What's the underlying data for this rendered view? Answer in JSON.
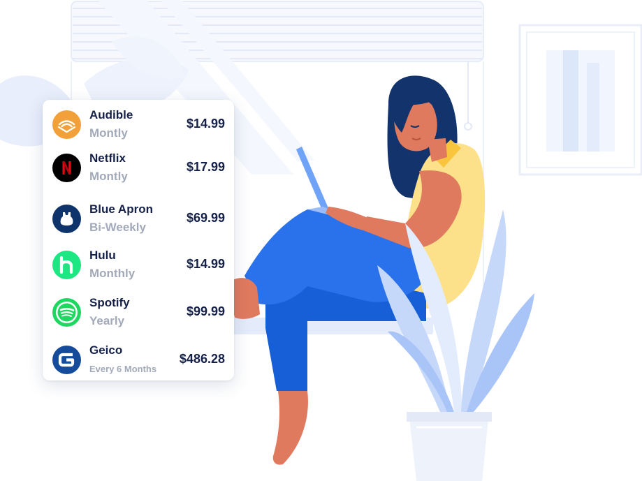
{
  "colors": {
    "background": "#ffffff",
    "text_primary": "#152148",
    "text_secondary": "#a2a9b8",
    "card": "#ffffff",
    "illustration_light_blue": "#e6edfb",
    "jeans_blue": "#2469e0",
    "shirt_yellow": "#fde08a",
    "skin": "#df7a5f",
    "hair_navy": "#12336b"
  },
  "subscriptions": [
    {
      "name": "Audible",
      "frequency": "Montly",
      "price": "$14.99",
      "logo": "audible-logo-icon",
      "color": "#f1a03a"
    },
    {
      "name": "Netflix",
      "frequency": "Montly",
      "price": "$17.99",
      "logo": "netflix-logo-icon",
      "color": "#000000"
    },
    {
      "name": "Blue Apron",
      "frequency": "Bi-Weekly",
      "price": "$69.99",
      "logo": "blue-apron-logo-icon",
      "color": "#0f346c"
    },
    {
      "name": "Hulu",
      "frequency": "Monthly",
      "price": "$14.99",
      "logo": "hulu-logo-icon",
      "color": "#1ce783"
    },
    {
      "name": "Spotify",
      "frequency": "Yearly",
      "price": "$99.99",
      "logo": "spotify-logo-icon",
      "color": "#1ed760"
    },
    {
      "name": "Geico",
      "frequency": "Every 6 Months",
      "price": "$486.28",
      "logo": "geico-logo-icon",
      "color": "#154b9b"
    }
  ]
}
